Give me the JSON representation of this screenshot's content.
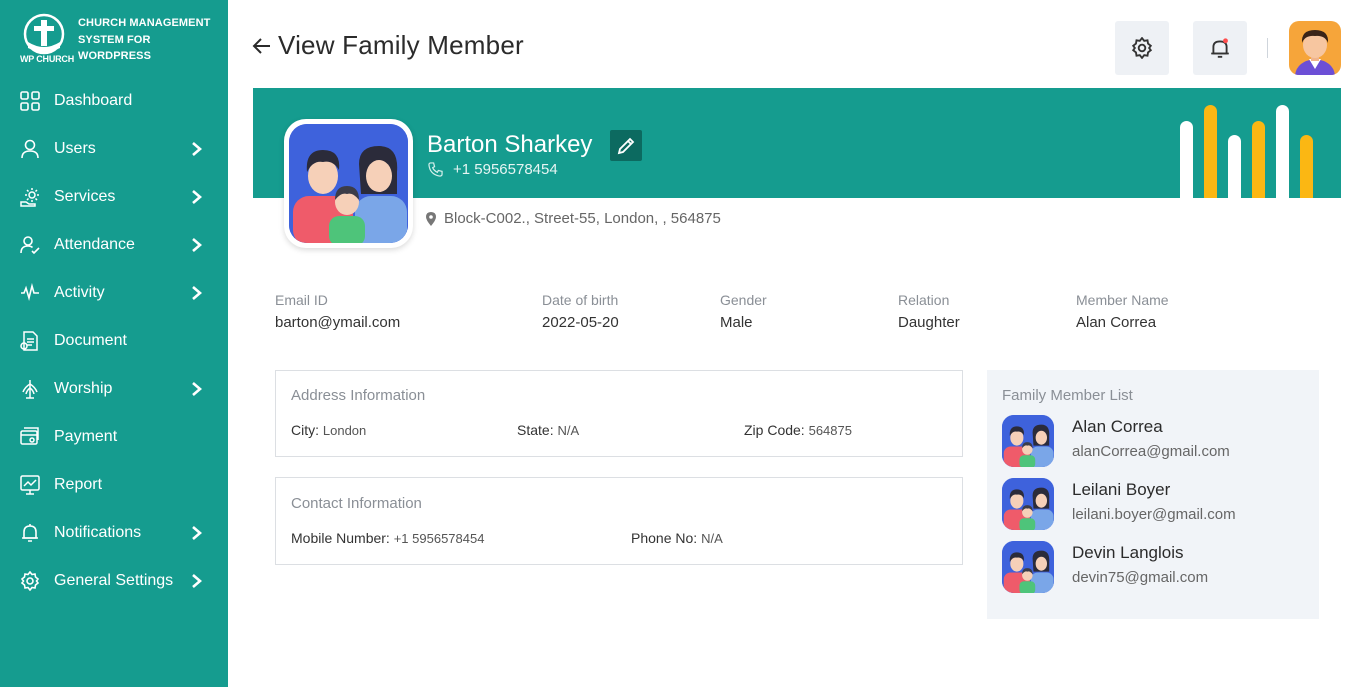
{
  "app": {
    "logo_line1": "CHURCH MANAGEMENT",
    "logo_line2": "SYSTEM FOR",
    "logo_line3": "WORDPRESS",
    "logo_sub": "WP CHURCH",
    "accent": "#159c8f",
    "gold": "#fbb713"
  },
  "sidebar": {
    "items": [
      {
        "label": "Dashboard",
        "icon": "grid-icon",
        "chevron": false
      },
      {
        "label": "Users",
        "icon": "user-icon",
        "chevron": true
      },
      {
        "label": "Services",
        "icon": "services-icon",
        "chevron": true
      },
      {
        "label": "Attendance",
        "icon": "attendance-icon",
        "chevron": true
      },
      {
        "label": "Activity",
        "icon": "activity-icon",
        "chevron": true
      },
      {
        "label": "Document",
        "icon": "document-icon",
        "chevron": false
      },
      {
        "label": "Worship",
        "icon": "worship-icon",
        "chevron": true
      },
      {
        "label": "Payment",
        "icon": "payment-icon",
        "chevron": false
      },
      {
        "label": "Report",
        "icon": "report-icon",
        "chevron": false
      },
      {
        "label": "Notifications",
        "icon": "bell-icon",
        "chevron": true
      },
      {
        "label": "General Settings",
        "icon": "gear-icon",
        "chevron": true
      }
    ]
  },
  "header": {
    "title": "View Family Member"
  },
  "profile": {
    "name": "Barton Sharkey",
    "phone": "+1 5956578454",
    "address": "Block-C002., Street-55, London, , 564875"
  },
  "details": {
    "email_label": "Email ID",
    "email": "barton@ymail.com",
    "dob_label": "Date of birth",
    "dob": "2022-05-20",
    "gender_label": "Gender",
    "gender": "Male",
    "relation_label": "Relation",
    "relation": "Daughter",
    "member_label": "Member Name",
    "member": "Alan Correa"
  },
  "address_info": {
    "title": "Address Information",
    "city_label": "City:",
    "city": "London",
    "state_label": "State:",
    "state": "N/A",
    "zip_label": "Zip Code:",
    "zip": "564875"
  },
  "contact_info": {
    "title": "Contact Information",
    "mobile_label": "Mobile Number:",
    "mobile": "+1 5956578454",
    "phone_label": "Phone No:",
    "phone": "N/A"
  },
  "family_list": {
    "title": "Family Member List",
    "members": [
      {
        "name": "Alan Correa",
        "email": "alanCorrea@gmail.com"
      },
      {
        "name": "Leilani Boyer",
        "email": "leilani.boyer@gmail.com"
      },
      {
        "name": "Devin Langlois",
        "email": "devin75@gmail.com"
      }
    ]
  }
}
